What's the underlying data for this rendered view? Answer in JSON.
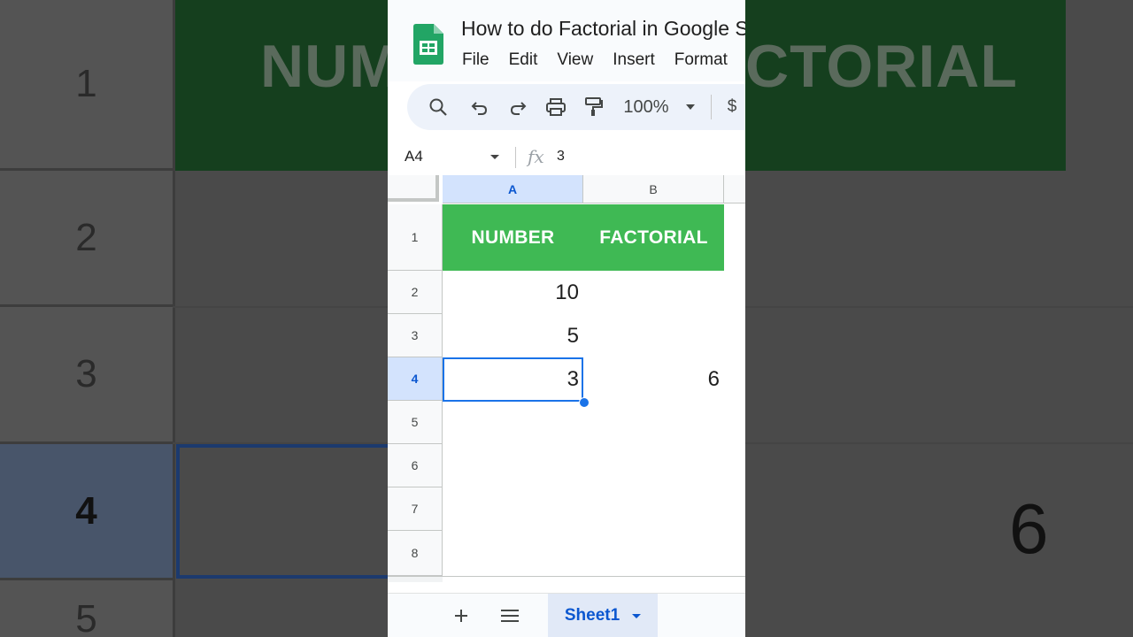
{
  "doc": {
    "title": "How to do Factorial in Google Sheets",
    "menu": [
      "File",
      "Edit",
      "View",
      "Insert",
      "Format"
    ]
  },
  "toolbar": {
    "zoom": "100%",
    "currency": "$"
  },
  "formula_bar": {
    "name_box": "A4",
    "fx": "fx",
    "value": "3"
  },
  "grid": {
    "columns": [
      "A",
      "B"
    ],
    "rows": [
      "1",
      "2",
      "3",
      "4",
      "5",
      "6",
      "7",
      "8"
    ],
    "selected_cell": "A4",
    "header": {
      "a": "NUMBER",
      "b": "FACTORIAL"
    },
    "cells": {
      "a2": "10",
      "a3": "5",
      "a4": "3",
      "b4": "6"
    },
    "header_color": "#3fb954",
    "selection_color": "#1a73e8"
  },
  "tabs": {
    "sheet": "Sheet1"
  },
  "background": {
    "rows": [
      "1",
      "2",
      "3",
      "4",
      "5"
    ],
    "header_left": "NUM",
    "header_right": "CTORIAL",
    "value": "6"
  }
}
